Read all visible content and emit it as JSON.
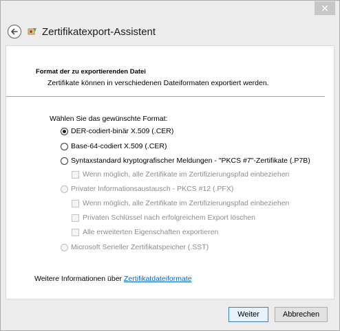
{
  "window": {
    "close_glyph": "✕"
  },
  "header": {
    "title": "Zertifikatexport-Assistent"
  },
  "section": {
    "title": "Format der zu exportierenden Datei",
    "description": "Zertifikate können in verschiedenen Dateiformaten exportiert werden."
  },
  "prompt": "Wählen Sie das gewünschte Format:",
  "options": {
    "der": {
      "label": "DER-codiert-binär X.509 (.CER)",
      "selected": true
    },
    "base64": {
      "label": "Base-64-codiert X.509 (.CER)",
      "selected": false
    },
    "pkcs7": {
      "label": "Syntaxstandard kryptografischer Meldungen - \"PKCS #7\"-Zertifikate (.P7B)",
      "selected": false
    },
    "pkcs7_include_chain": "Wenn möglich, alle Zertifikate im Zertifizierungspfad einbeziehen",
    "pfx": {
      "label": "Privater Informationsaustausch - PKCS #12 (.PFX)",
      "selected": false,
      "disabled": true
    },
    "pfx_include_chain": "Wenn möglich, alle Zertifikate im Zertifizierungspfad einbeziehen",
    "pfx_delete_key": "Privaten Schlüssel nach erfolgreichem Export löschen",
    "pfx_export_props": "Alle erweiterten Eigenschaften exportieren",
    "sst": {
      "label": "Microsoft Serieller Zertifikatspeicher (.SST)",
      "selected": false,
      "disabled": true
    }
  },
  "more_info": {
    "prefix": "Weitere Informationen über ",
    "link": "Zertifikatdateiformate"
  },
  "buttons": {
    "next": "Weiter",
    "cancel": "Abbrechen"
  },
  "colors": {
    "link": "#0066cc",
    "primary_button_border": "#3c7fb1",
    "disabled_text": "#8c8c8c"
  }
}
